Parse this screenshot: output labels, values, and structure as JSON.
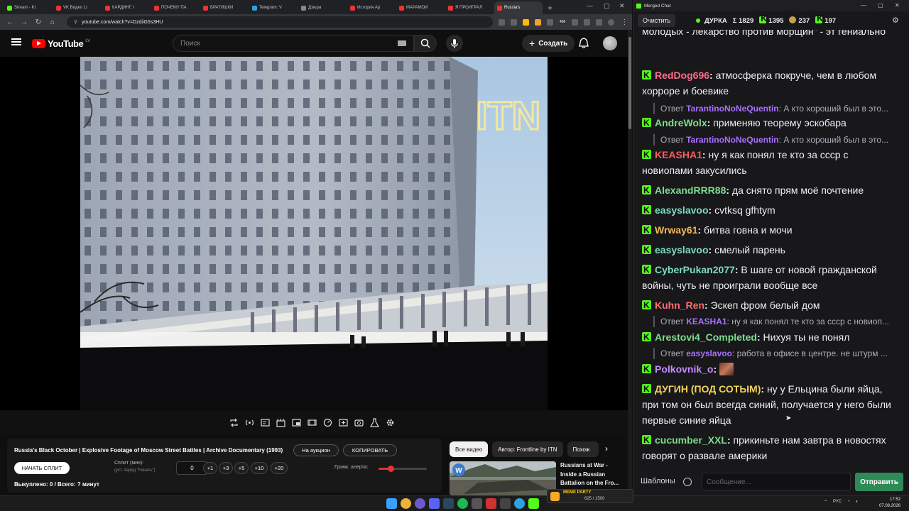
{
  "browser": {
    "tabs": [
      {
        "label": "Stream - Ki",
        "color": "#53fc18"
      },
      {
        "label": "VK Видео Li",
        "color": "#e33"
      },
      {
        "label": "КАРДИНГ. I",
        "color": "#e33"
      },
      {
        "label": "ПОЧЕМУ ПА",
        "color": "#e33"
      },
      {
        "label": "БРАТИШКИ",
        "color": "#e33"
      },
      {
        "label": "Telegram: V",
        "color": "#2aa3e0"
      },
      {
        "label": "Дзюра",
        "color": "#888"
      },
      {
        "label": "История Ар",
        "color": "#e33"
      },
      {
        "label": "МАРАМОИ",
        "color": "#e33"
      },
      {
        "label": "Я ПРОИГРАЛ",
        "color": "#e33"
      },
      {
        "label": "Russia's",
        "color": "#e33"
      }
    ],
    "url": "youtube.com/watch?v=DzdiiG5s3HU",
    "new_tab": "+",
    "extension_badge": "496"
  },
  "youtube": {
    "logo_text": "YouTube",
    "logo_country": "LV",
    "search_placeholder": "Поиск",
    "create_label": "Создать",
    "video": {
      "watermark": "ITN"
    },
    "title": "Russia's Black October | Explosive Footage of Moscow Street Battles | Archive Documentary (1993)",
    "auction_label": "На аукцион",
    "copy_label": "КОПИРОВАТЬ",
    "start_split_label": "НАЧАТЬ СПЛИТ",
    "split_label": "Сплит (мин):",
    "split_hint": "(уст. перед \"Начать\")",
    "split_value": "0",
    "steps": [
      "+1",
      "+3",
      "+5",
      "+10",
      "+20"
    ],
    "alert_volume_label": "Громк. алерта:",
    "alert_volume": 0.25,
    "sold_text": "Выкуплено: 0 / Всего: ? минут",
    "chips": [
      "Все видео",
      "Автор: Frontline by ITN",
      "Похож"
    ],
    "recommended": {
      "title": "Russians at War - Inside a Russian Battalion on the Fro..."
    }
  },
  "chat": {
    "window_title": "Merged Chat",
    "clear_label": "Очистить",
    "channel": "ДУРКА",
    "stats": [
      {
        "icon": "sigma",
        "value": "Σ 1829"
      },
      {
        "icon": "kick-icon",
        "value": "1395"
      },
      {
        "icon": "cat-icon",
        "value": "237"
      },
      {
        "icon": "kick-icon-2",
        "value": "197"
      }
    ],
    "messages": [
      {
        "text": "молодых - лекарство против морщин\" - эт гениально"
      },
      {
        "user": "RedDog696",
        "color": "#ff6b8a",
        "text": "атмосферка покруче, чем в любом хорроре и боевике"
      },
      {
        "reply_to": "TarantinoNoNeQuentin",
        "reply_color": "#a970ff",
        "reply_text": "А кто хороший был в это..."
      },
      {
        "user": "AndreWolx",
        "color": "#7ddc8f",
        "text": "применяю теорему эскобара"
      },
      {
        "reply_to": "TarantinoNoNeQuentin",
        "reply_color": "#a970ff",
        "reply_text": "А кто хороший был в это..."
      },
      {
        "user": "KEASHA1",
        "color": "#ff5c5c",
        "text": "ну я как понял те кто за ссср с новиопами закусились"
      },
      {
        "user": "AlexandRRR88",
        "color": "#7ddc8f",
        "text": "да снято прям моё почтение"
      },
      {
        "user": "easyslavoo",
        "color": "#7ddcc0",
        "text": "cvtksq gfhtym"
      },
      {
        "user": "Wrway61",
        "color": "#f5b85a",
        "text": "битва говна и мочи"
      },
      {
        "user": "easyslavoo",
        "color": "#7ddcc0",
        "text": "смелый парень"
      },
      {
        "user": "CyberPukan2077",
        "color": "#7ddcc0",
        "text": "В шаге от новой гражданской войны, чуть не проиграли вообще все"
      },
      {
        "user": "Kuhn_Ren",
        "color": "#ff6b6b",
        "text": "Эскеп фром белый дом"
      },
      {
        "reply_to": "KEASHA1",
        "reply_color": "#a970ff",
        "reply_text": "ну я как понял те кто за ссср с новиоп..."
      },
      {
        "user": "Arestovi4_Completed",
        "color": "#7ddc8f",
        "text": "Нихуя ты не понял"
      },
      {
        "reply_to": "easyslavoo",
        "reply_color": "#a970ff",
        "reply_text": "работа в офисе в центре. не штурм ..."
      },
      {
        "user": "Polkovnik_o",
        "color": "#c58cff",
        "text": ""
      },
      {
        "user": "ДУГИН (ПОД СОТЫМ)",
        "color": "#f5d35a",
        "text": "ну у Ельцина были яйца, при том он был всегда синий, получается у него были первые синие яйца"
      },
      {
        "user": "cucumber_XXL",
        "color": "#7ddc8f",
        "text": "прикиньте нам завтра в новостях говорят о развале америки"
      }
    ],
    "reply_prefix": "Ответ",
    "templates_label": "Шаблоны",
    "input_placeholder": "Сообщение...",
    "send_label": "Отправить"
  },
  "taskbar": {
    "meme_label": "MEME PARTY",
    "meme_progress": "625 / 1500",
    "lang": "РУС",
    "time": "17:52",
    "date": "07.08.2026"
  }
}
